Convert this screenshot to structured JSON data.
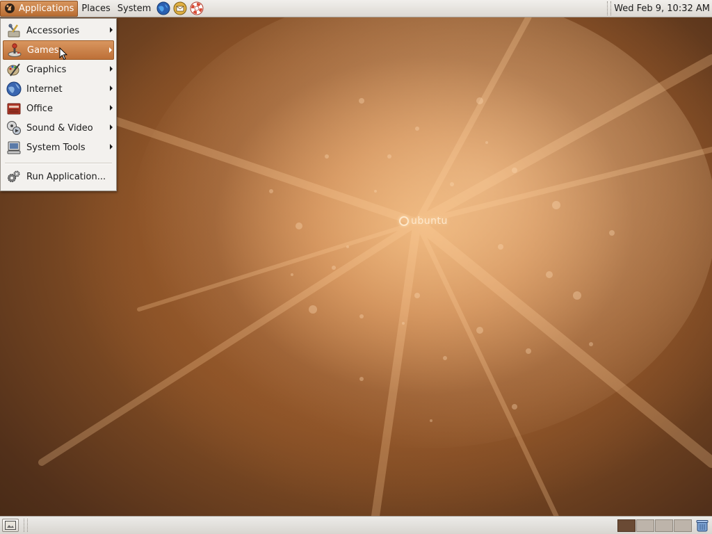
{
  "top_panel": {
    "applications_label": "Applications",
    "places_label": "Places",
    "system_label": "System",
    "launchers": [
      "web-browser-icon",
      "email-icon",
      "help-icon"
    ],
    "clock": "Wed Feb  9, 10:32 AM"
  },
  "applications_menu": {
    "items": [
      {
        "label": "Accessories",
        "icon": "accessories-icon",
        "submenu": true
      },
      {
        "label": "Games",
        "icon": "games-icon",
        "submenu": true,
        "highlighted": true
      },
      {
        "label": "Graphics",
        "icon": "graphics-icon",
        "submenu": true
      },
      {
        "label": "Internet",
        "icon": "internet-icon",
        "submenu": true
      },
      {
        "label": "Office",
        "icon": "office-icon",
        "submenu": true
      },
      {
        "label": "Sound & Video",
        "icon": "sound-video-icon",
        "submenu": true
      },
      {
        "label": "System Tools",
        "icon": "system-tools-icon",
        "submenu": true
      }
    ],
    "run_application_label": "Run Application..."
  },
  "desktop": {
    "logo_text": "ubuntu"
  },
  "bottom_panel": {
    "workspaces": 4,
    "current_workspace": 1
  },
  "colors": {
    "highlight": "#c17a41",
    "panel": "#e6e3de",
    "wallpaper": "#9a5c2c"
  }
}
